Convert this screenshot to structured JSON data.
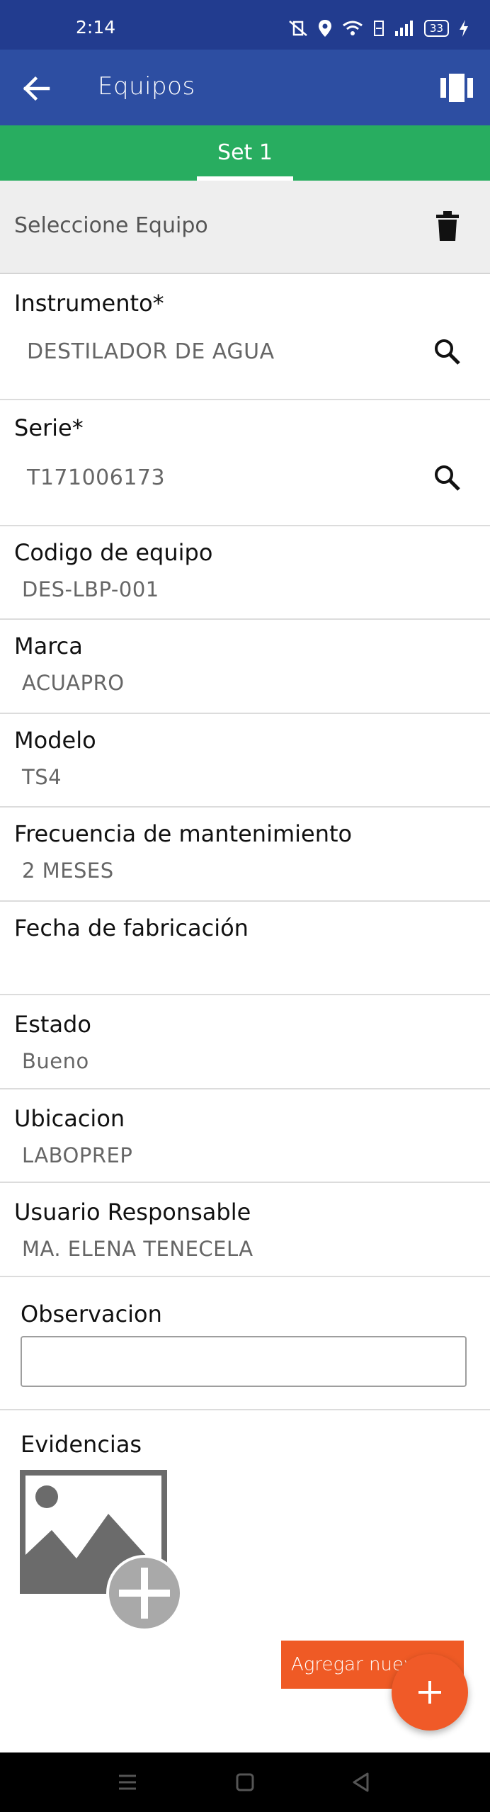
{
  "status_bar": {
    "time": "2:14",
    "battery": "33"
  },
  "app_bar": {
    "title": "Equipos",
    "back_icon": "arrow-left-icon",
    "view_icon": "view-carousel-icon"
  },
  "tabs": [
    {
      "label": "Set 1",
      "selected": true
    }
  ],
  "selector": {
    "label": "Seleccione Equipo",
    "delete_icon": "trash-icon"
  },
  "fields": {
    "instrumento": {
      "label": "Instrumento*",
      "value": "DESTILADOR DE AGUA"
    },
    "serie": {
      "label": "Serie*",
      "value": "T171006173"
    },
    "codigo": {
      "label": "Codigo de equipo",
      "value": "DES-LBP-001"
    },
    "marca": {
      "label": "Marca",
      "value": "ACUAPRO"
    },
    "modelo": {
      "label": "Modelo",
      "value": "TS4"
    },
    "frecuencia": {
      "label": "Frecuencia de mantenimiento",
      "value": "2 MESES"
    },
    "fecha": {
      "label": "Fecha de fabricación",
      "value": ""
    },
    "estado": {
      "label": "Estado",
      "value": "Bueno"
    },
    "ubicacion": {
      "label": "Ubicacion",
      "value": "LABOPREP"
    },
    "usuario": {
      "label": "Usuario Responsable",
      "value": "MA. ELENA TENECELA"
    },
    "observacion": {
      "label": "Observacion",
      "value": ""
    }
  },
  "evidencias": {
    "label": "Evidencias",
    "add_icon": "add-image-icon"
  },
  "actions": {
    "add_new_label": "Agregar nuevo",
    "fab_icon": "plus-icon"
  },
  "colors": {
    "status_bar": "#223c8f",
    "app_bar": "#2d4ea2",
    "tab_bar": "#28ad60",
    "accent": "#f05a28"
  }
}
